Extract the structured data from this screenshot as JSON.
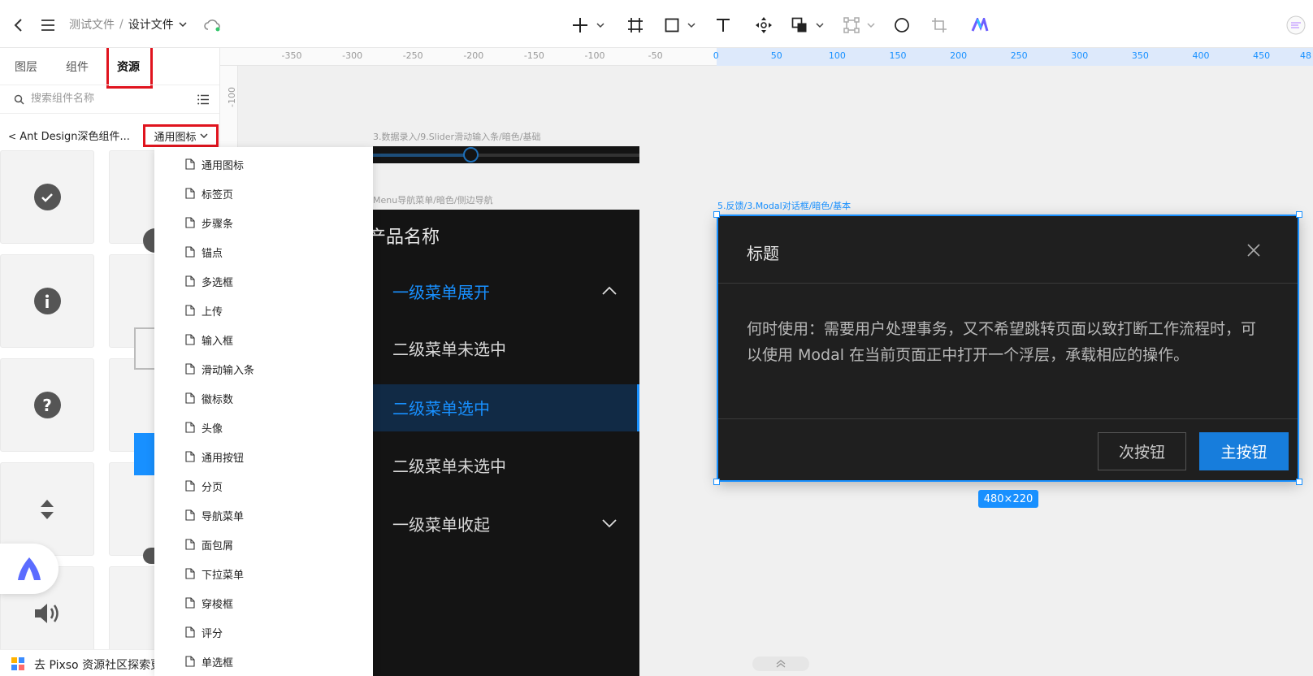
{
  "topbar": {
    "breadcrumb_root": "测试文件",
    "separator": "/",
    "breadcrumb_current": "设计文件"
  },
  "panel": {
    "tabs": [
      "图层",
      "组件",
      "资源"
    ],
    "active_tab": "资源",
    "search_placeholder": "搜索组件名称",
    "library_name": "Ant Design深色组件...",
    "category_selected": "通用图标",
    "bottom_link": "去 Pixso 资源社区探索更"
  },
  "dropdown": {
    "items": [
      "通用图标",
      "标签页",
      "步骤条",
      "锚点",
      "多选框",
      "上传",
      "输入框",
      "滑动输入条",
      "徽标数",
      "头像",
      "通用按钮",
      "分页",
      "导航菜单",
      "面包屑",
      "下拉菜单",
      "穿梭框",
      "评分",
      "单选框"
    ]
  },
  "ruler": {
    "ticks": [
      "-350",
      "-300",
      "-250",
      "-200",
      "-150",
      "-100",
      "-50",
      "0",
      "50",
      "100",
      "150",
      "200",
      "250",
      "300",
      "350",
      "400",
      "450",
      "48"
    ],
    "left_tick": "-100"
  },
  "canvas": {
    "slider_label": "3.数据录入/9.Slider滑动输入条/暗色/基础",
    "menu_label": "Menu导航菜单/暗色/侧边导航",
    "menu": {
      "product": "产品名称",
      "items": [
        "一级菜单展开",
        "二级菜单未选中",
        "二级菜单选中",
        "二级菜单未选中",
        "一级菜单收起"
      ]
    },
    "modal_label": "5.反馈/3.Modal对话框/暗色/基本",
    "modal": {
      "title": "标题",
      "body_line1": "何时使用：需要用户处理事务，又不希望跳转页面以致打断工作流程时，可",
      "body_line2": "以使用 Modal 在当前页面正中打开一个浮层，承载相应的操作。",
      "secondary_button": "次按钮",
      "primary_button": "主按钮"
    },
    "selection_size": "480×220"
  },
  "colors": {
    "accent": "#1890ff",
    "highlight_red": "#e0141e",
    "dark_bg": "#141414",
    "modal_bg": "#1f1f1f"
  }
}
